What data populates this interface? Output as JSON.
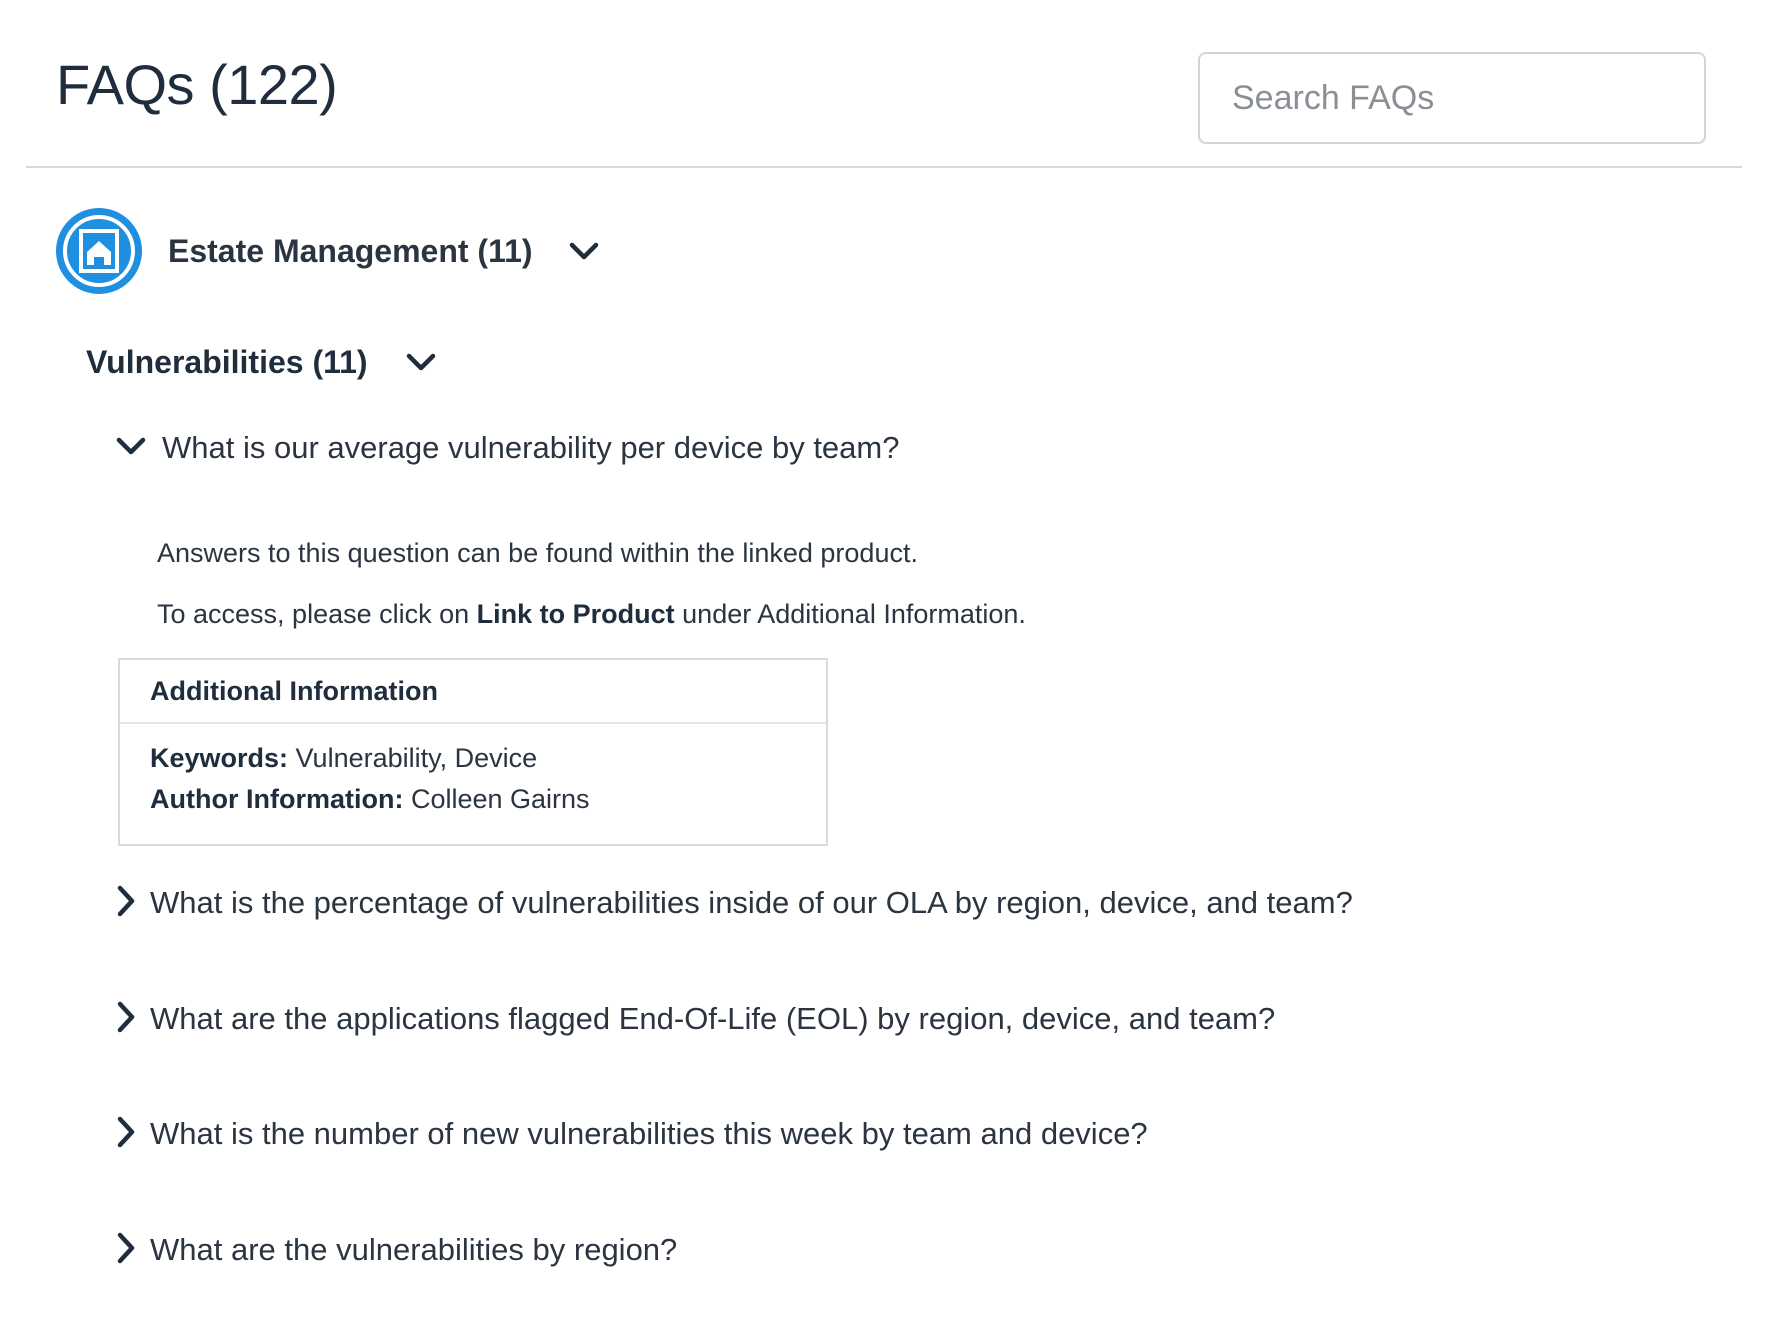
{
  "header": {
    "title": "FAQs (122)",
    "search_placeholder": "Search FAQs",
    "search_icon": "search-icon"
  },
  "category": {
    "label": "Estate Management (11)",
    "icon": "home-icon",
    "icon_color": "#1e8fe1"
  },
  "subcategory": {
    "label": "Vulnerabilities (11)"
  },
  "open_question": {
    "text": "What is our average vulnerability per device by team?",
    "answer_line1": "Answers to this question can be found within the linked product.",
    "answer_line2_prefix": "To access, please click on ",
    "answer_line2_bold": "Link to Product",
    "answer_line2_suffix": " under Additional Information.",
    "info": {
      "title": "Additional Information",
      "keywords_label": "Keywords:",
      "keywords_value": " Vulnerability, Device",
      "author_label": "Author Information:",
      "author_value": " Colleen Gairns"
    }
  },
  "questions": [
    {
      "text": "What is the percentage of vulnerabilities inside of our OLA by region, device, and team?"
    },
    {
      "text": "What are the applications flagged End-Of-Life (EOL) by region, device, and team?"
    },
    {
      "text": "What is the number of new vulnerabilities this week by team and device?"
    },
    {
      "text": "What are the vulnerabilities by region?"
    }
  ]
}
